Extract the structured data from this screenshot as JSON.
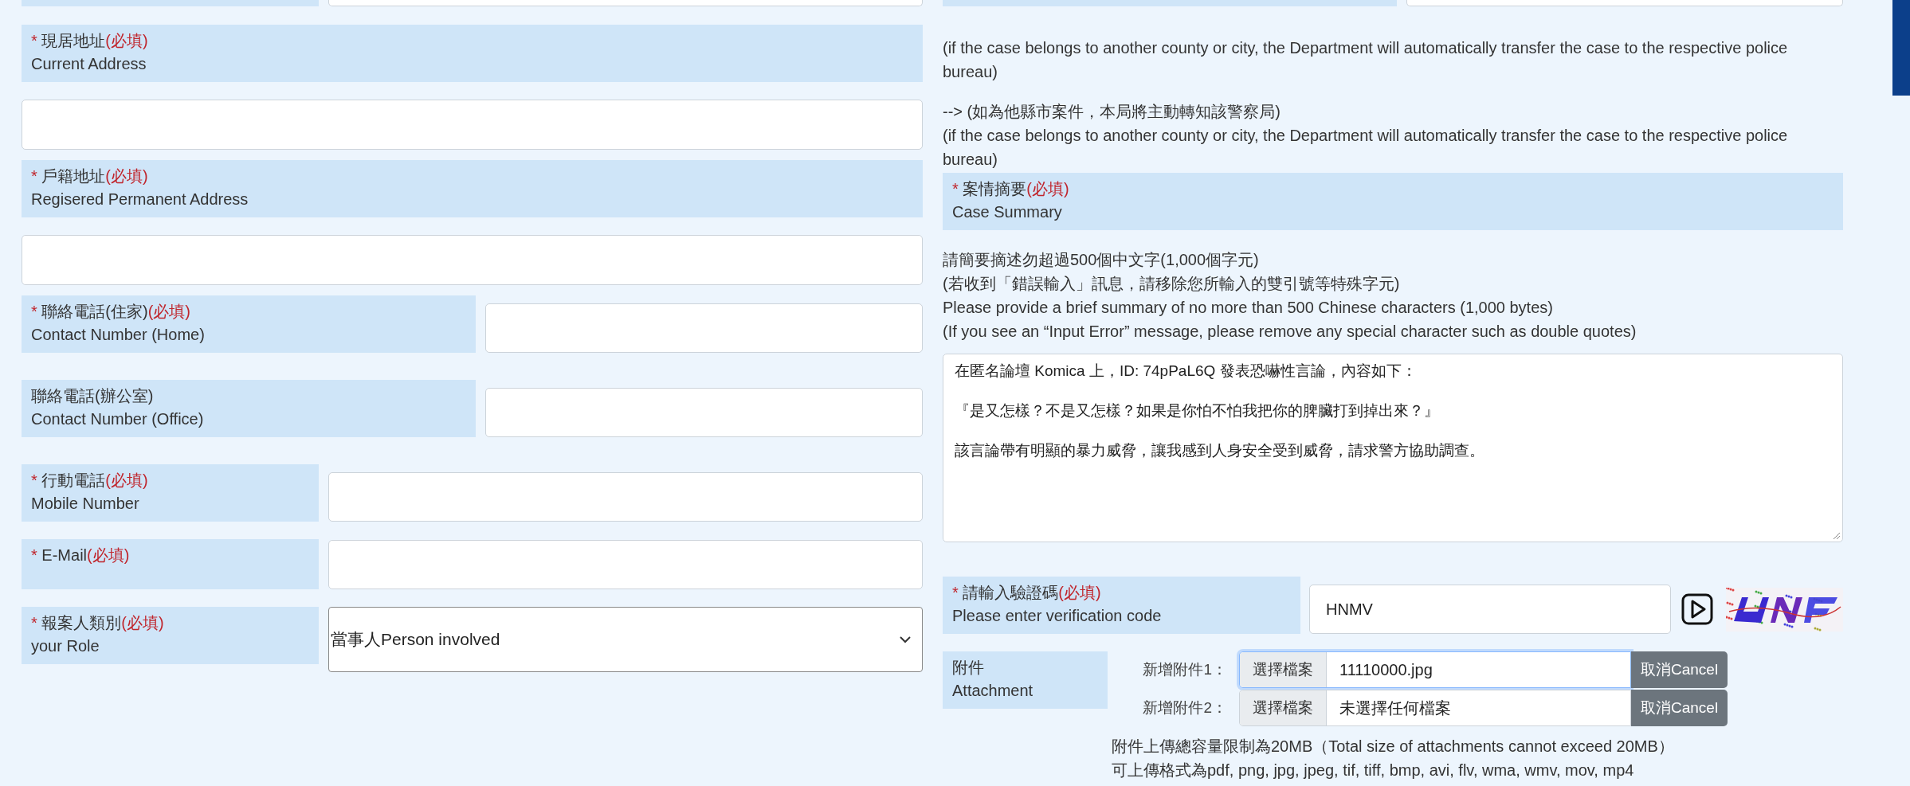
{
  "left_fields": [
    {
      "kind": "stacked",
      "label": {
        "star": "*",
        "zh": "現居地址",
        "note": "(必填)",
        "en": "Current Address"
      }
    },
    {
      "kind": "stacked",
      "label": {
        "star": "*",
        "zh": "戶籍地址",
        "note": "(必填)",
        "en": "Regisered Permanent Address"
      }
    },
    {
      "kind": "half",
      "label": {
        "star": "*",
        "zh": "聯絡電話(住家)",
        "note": "(必填)",
        "en": "Contact Number (Home)"
      }
    },
    {
      "kind": "half",
      "label": {
        "zh": "聯絡電話(辦公室)",
        "en": "Contact Number (Office)"
      }
    },
    {
      "kind": "narrow",
      "label": {
        "star": "*",
        "zh": "行動電話",
        "note": "(必填)",
        "en": "Mobile Number"
      }
    },
    {
      "kind": "narrow",
      "label": {
        "star": "*",
        "zh": "E-Mail",
        "note": "(必填)"
      }
    },
    {
      "kind": "narrow",
      "select": {
        "value": "當事人Person involved"
      },
      "label": {
        "star": "*",
        "zh": "報案人類別",
        "note": "(必填)",
        "en": "your Role"
      }
    }
  ],
  "transfer_notes": [
    [
      "(if the case belongs to another county or city, the Department will automatically transfer the case to the respective police bureau)"
    ],
    [
      "--> (如為他縣市案件，本局將主動轉知該警察局)",
      "(if the case belongs to another county or city, the Department will automatically transfer the case to the respective police bureau)"
    ]
  ],
  "case_summary": {
    "label": {
      "star": "*",
      "zh": "案情摘要",
      "note": "(必填)",
      "en": "Case Summary"
    },
    "hints": [
      "請簡要摘述勿超過500個中文字(1,000個字元)",
      "(若收到「錯誤輸入」訊息，請移除您所輸入的雙引號等特殊字元)",
      "Please provide a brief summary of no more than 500 Chinese characters (1,000 bytes)",
      "(If you see an “Input Error” message, please remove any special character such as double quotes)"
    ],
    "paragraphs": [
      "在匿名論壇 Komica 上，ID: 74pPaL6Q 發表恐嚇性言論，內容如下：",
      "『是又怎樣？不是又怎樣？如果是你怕不怕我把你的脾臟打到掉出來？』",
      "該言論帶有明顯的暴力威脅，讓我感到人身安全受到威脅，請求警方協助調查。"
    ]
  },
  "captcha": {
    "label": {
      "star": "*",
      "zh": "請輸入驗證碼",
      "note": "(必填)",
      "en": "Please enter verification code"
    },
    "value": "HNMV"
  },
  "attachments": {
    "label": {
      "zh": "附件",
      "en": "Attachment"
    },
    "rows": [
      {
        "label": "新增附件1：",
        "button": "選擇檔案",
        "file": "11110000.jpg",
        "focused": true,
        "cancel": "取消Cancel"
      },
      {
        "label": "新增附件2：",
        "button": "選擇檔案",
        "file": "未選擇任何檔案",
        "focused": false,
        "cancel": "取消Cancel"
      }
    ],
    "notes": [
      "附件上傳總容量限制為20MB（Total size of attachments cannot exceed 20MB）",
      "可上傳格式為pdf, png, jpg, jpeg, tif, tiff, bmp, avi, flv, wma, wmv, mov, mp4"
    ]
  }
}
